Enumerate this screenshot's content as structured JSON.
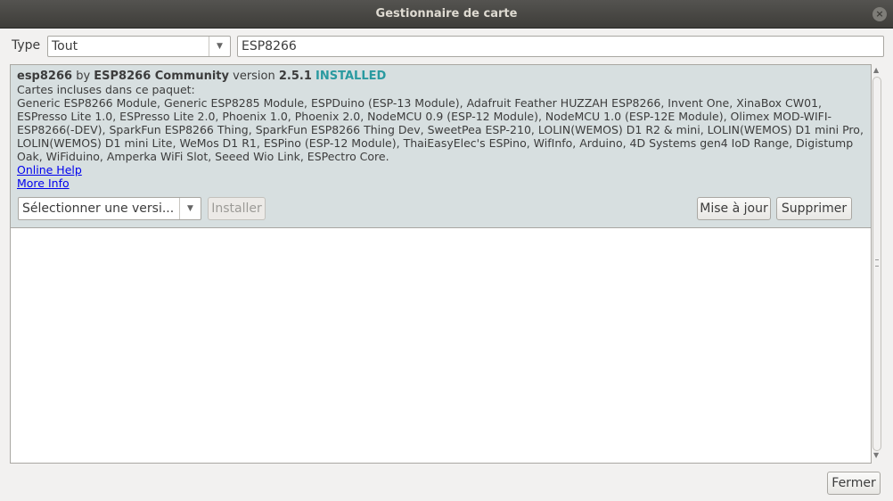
{
  "window": {
    "title": "Gestionnaire de carte",
    "close_glyph": "×"
  },
  "filter": {
    "type_label": "Type",
    "type_value": "Tout",
    "search_value": "ESP8266"
  },
  "package": {
    "name": "esp8266",
    "by_word": "by",
    "author": "ESP8266 Community",
    "version_word": "version",
    "version": "2.5.1",
    "status": "INSTALLED",
    "included_label": "Cartes incluses dans ce paquet:",
    "boards": "Generic ESP8266 Module, Generic ESP8285 Module, ESPDuino (ESP-13 Module), Adafruit Feather HUZZAH ESP8266, Invent One, XinaBox CW01, ESPresso Lite 1.0, ESPresso Lite 2.0, Phoenix 1.0, Phoenix 2.0, NodeMCU 0.9 (ESP-12 Module), NodeMCU 1.0 (ESP-12E Module), Olimex MOD-WIFI-ESP8266(-DEV), SparkFun ESP8266 Thing, SparkFun ESP8266 Thing Dev, SweetPea ESP-210, LOLIN(WEMOS) D1 R2 & mini, LOLIN(WEMOS) D1 mini Pro, LOLIN(WEMOS) D1 mini Lite, WeMos D1 R1, ESPino (ESP-12 Module), ThaiEasyElec's ESPino, WifInfo, Arduino, 4D Systems gen4 IoD Range, Digistump Oak, WiFiduino, Amperka WiFi Slot, Seeed Wio Link, ESPectro Core.",
    "online_help": "Online Help",
    "more_info": "More Info",
    "version_select": "Sélectionner une versi...",
    "install_label": "Installer",
    "update_label": "Mise à jour",
    "remove_label": "Supprimer"
  },
  "footer": {
    "close_label": "Fermer"
  },
  "colors": {
    "installed": "#2a9aa0",
    "selected_row": "#d7dfe0",
    "titlebar": "#3e3d39"
  }
}
